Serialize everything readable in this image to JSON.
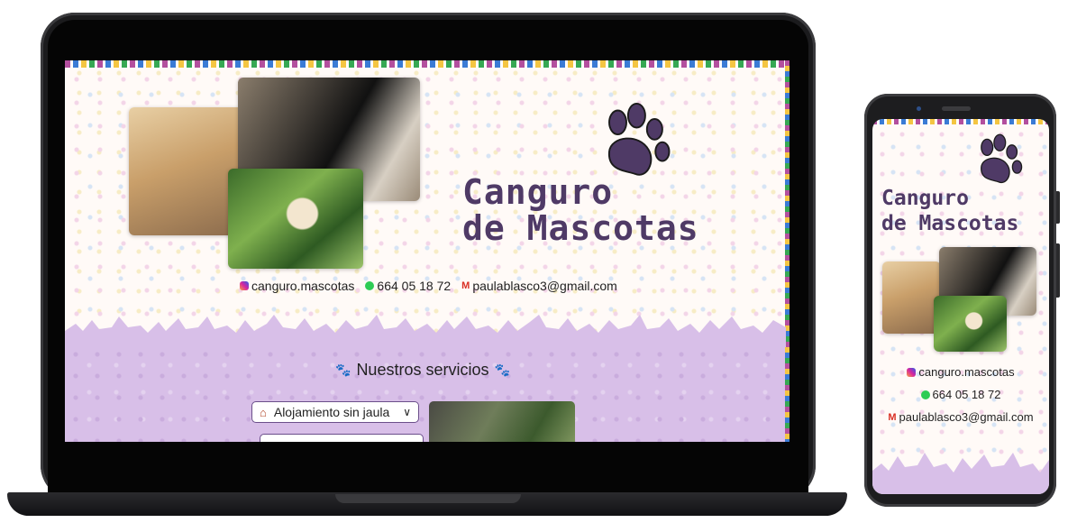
{
  "desktop": {
    "logo": {
      "line1": "Canguro",
      "line2": "de Mascotas"
    },
    "contacts": {
      "instagram": "canguro.mascotas",
      "phone": "664 05 18 72",
      "email": "paulablasco3@gmail.com"
    },
    "services": {
      "title": "Nuestros servicios",
      "items": [
        {
          "label": "Alojamiento sin jaula",
          "icon": "house-icon"
        }
      ]
    }
  },
  "mobile": {
    "logo": {
      "line1": "Canguro",
      "line2": "de Mascotas"
    },
    "contacts": {
      "instagram": "canguro.mascotas",
      "phone": "664 05 18 72",
      "email": "paulablasco3@gmail.com"
    }
  },
  "colors": {
    "brand": "#4f3a66",
    "band": "#d8bfe8",
    "border": "#6b4f8a"
  }
}
